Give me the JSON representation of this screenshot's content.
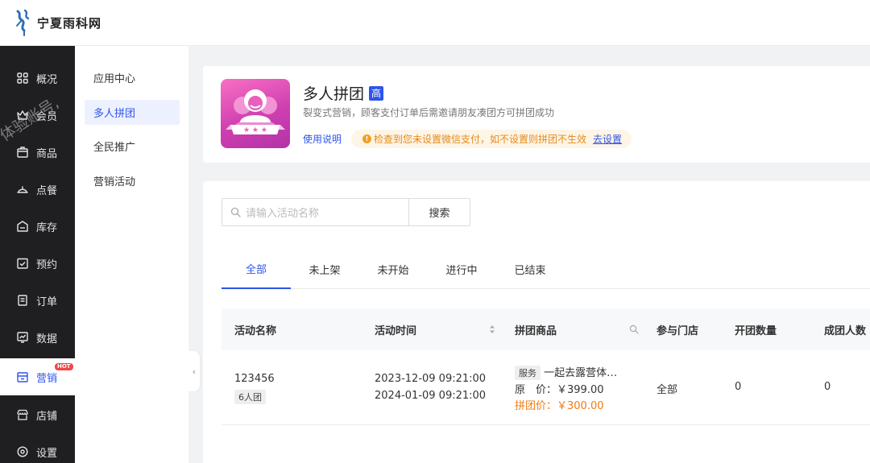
{
  "header": {
    "logo_text": "宁夏雨科网"
  },
  "watermark": "体验账号,",
  "sidebar": {
    "items": [
      {
        "label": "概况",
        "icon": "grid-icon"
      },
      {
        "label": "会员",
        "icon": "crown-icon"
      },
      {
        "label": "商品",
        "icon": "box-icon"
      },
      {
        "label": "点餐",
        "icon": "dish-icon"
      },
      {
        "label": "库存",
        "icon": "warehouse-icon"
      },
      {
        "label": "预约",
        "icon": "calendar-check-icon"
      },
      {
        "label": "订单",
        "icon": "receipt-icon"
      },
      {
        "label": "数据",
        "icon": "chart-icon"
      },
      {
        "label": "营销",
        "icon": "marketing-icon",
        "badge": "HOT"
      },
      {
        "label": "店铺",
        "icon": "store-icon"
      },
      {
        "label": "设置",
        "icon": "settings-icon"
      }
    ],
    "active": "营销"
  },
  "subnav": {
    "items": [
      {
        "label": "应用中心"
      },
      {
        "label": "多人拼团"
      },
      {
        "label": "全民推广"
      },
      {
        "label": "营销活动"
      }
    ],
    "active": "多人拼团"
  },
  "info": {
    "title": "多人拼团",
    "level": "高",
    "description": "裂变式营销，顾客支付订单后需邀请朋友凑团方可拼团成功",
    "help_link": "使用说明",
    "warning": "检查到您未设置微信支付，如不设置则拼团不生效",
    "warning_link": "去设置"
  },
  "search": {
    "placeholder": "请输入活动名称",
    "button": "搜索"
  },
  "tabs": [
    {
      "label": "全部"
    },
    {
      "label": "未上架"
    },
    {
      "label": "未开始"
    },
    {
      "label": "进行中"
    },
    {
      "label": "已结束"
    }
  ],
  "active_tab": "全部",
  "table": {
    "columns": [
      "活动名称",
      "活动时间",
      "拼团商品",
      "参与门店",
      "开团数量",
      "成团人数"
    ],
    "rows": [
      {
        "name": "123456",
        "group_size": "6人团",
        "start": "2023-12-09 09:21:00",
        "end": "2024-01-09 09:21:00",
        "product_tag": "服务",
        "product_name": "一起去露营体…",
        "original_price_label": "原　价：",
        "original_price": "￥399.00",
        "group_price_label": "拼团价：",
        "group_price": "￥300.00",
        "stores": "全部",
        "groups_opened": "0",
        "groups_completed": "0"
      }
    ]
  },
  "colors": {
    "accent": "#2f54eb",
    "sidebar_bg": "#1f1f22",
    "price_orange": "#f07b12",
    "warning": "#e58a1d"
  }
}
